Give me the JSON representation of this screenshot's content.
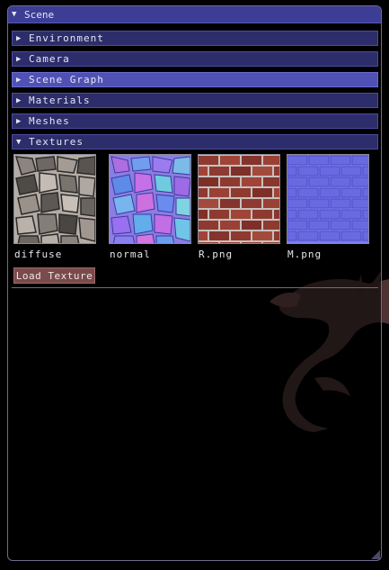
{
  "window": {
    "title": "Scene",
    "collapse_icon": "triangle-down-icon"
  },
  "sections": [
    {
      "label": "Environment",
      "expanded": false
    },
    {
      "label": "Camera",
      "expanded": false
    },
    {
      "label": "Scene Graph",
      "expanded": false,
      "highlighted": true
    },
    {
      "label": "Materials",
      "expanded": false
    },
    {
      "label": "Meshes",
      "expanded": false
    },
    {
      "label": "Textures",
      "expanded": true
    }
  ],
  "textures": [
    {
      "name": "diffuse",
      "kind": "stone-diffuse"
    },
    {
      "name": "normal",
      "kind": "stone-normal"
    },
    {
      "name": "R.png",
      "kind": "brick-diffuse"
    },
    {
      "name": "M.png",
      "kind": "brick-normal"
    }
  ],
  "load_button": {
    "label": "Load Texture"
  },
  "colors": {
    "title_bg": "#3c3d94",
    "header_bg": "#2c2d6a",
    "header_active_bg": "#4f52b4",
    "button_bg": "#7a4b4b"
  }
}
